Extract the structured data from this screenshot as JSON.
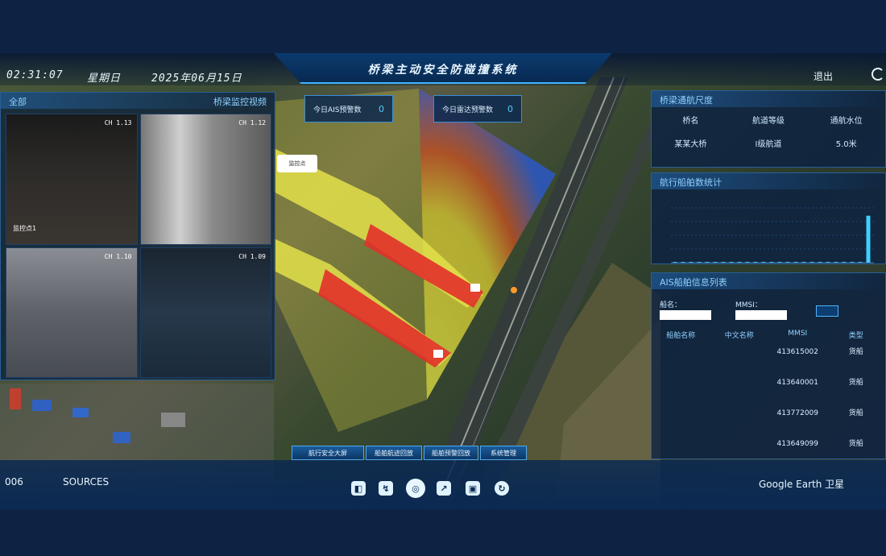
{
  "header": {
    "time": "02:31:07",
    "weekday": "星期日",
    "date": "2025年06月15日",
    "title": "桥梁主动安全防碰撞系统",
    "exit_label": "退出"
  },
  "video_panel": {
    "left_label": "全部",
    "right_label": "桥梁监控视频",
    "cameras": [
      {
        "corner": "CH 1.13",
        "caption": "监控点1"
      },
      {
        "corner": "CH 1.12",
        "caption": ""
      },
      {
        "corner": "CH 1.10",
        "caption": ""
      },
      {
        "corner": "CH 1.09",
        "caption": ""
      }
    ]
  },
  "stats": [
    {
      "label": "今日AIS预警数",
      "value": "0"
    },
    {
      "label": "今日雷达预警数",
      "value": "0"
    }
  ],
  "map_popup": {
    "text": "监控点"
  },
  "bridge_info": {
    "title": "桥梁通航尺度",
    "headers": [
      "桥名",
      "航道等级",
      "通航水位"
    ],
    "values": [
      "某某大桥",
      "Ⅰ级航道",
      "5.0米"
    ]
  },
  "flow_chart": {
    "title": "航行船舶数统计"
  },
  "chart_data": {
    "type": "bar",
    "categories": [
      "",
      "",
      "",
      "",
      "",
      "",
      "",
      "",
      "",
      "",
      "",
      "",
      "",
      "",
      "",
      "",
      "",
      "",
      "",
      "",
      "",
      "",
      "",
      "",
      ""
    ],
    "values": [
      0,
      0,
      0,
      0,
      0,
      0,
      0,
      0,
      0,
      0,
      0,
      0,
      0,
      0,
      0,
      0,
      0,
      0,
      0,
      0,
      0,
      0,
      0,
      0,
      12
    ],
    "ylim": [
      0,
      14
    ],
    "title": "",
    "xlabel": "",
    "ylabel": ""
  },
  "ais_panel": {
    "title": "AIS船舶信息列表",
    "filter_ship_label": "船名：",
    "filter_mmsi_label": "MMSI：",
    "columns": [
      "船舶名称",
      "中文名称",
      "MMSI",
      "类型"
    ],
    "rows": [
      {
        "name": "",
        "cn": "",
        "mmsi": "413615002",
        "type": "货船"
      },
      {
        "name": "",
        "cn": "",
        "mmsi": "413640001",
        "type": "货船"
      },
      {
        "name": "",
        "cn": "",
        "mmsi": "413772009",
        "type": "货船"
      },
      {
        "name": "",
        "cn": "",
        "mmsi": "413649099",
        "type": "货船"
      }
    ]
  },
  "bottom_tabs": [
    "航行安全大屏",
    "船舶航迹回放",
    "船舶预警回放",
    "系统管理"
  ],
  "footer": {
    "left_num": "006",
    "left_text": "SOURCES",
    "right_text": "Google Earth 卫星"
  },
  "colors": {
    "accent": "#3fb6ff",
    "panel": "#0a2042",
    "warning_red": "#e8302c",
    "warning_yellow": "#e5e24a"
  }
}
